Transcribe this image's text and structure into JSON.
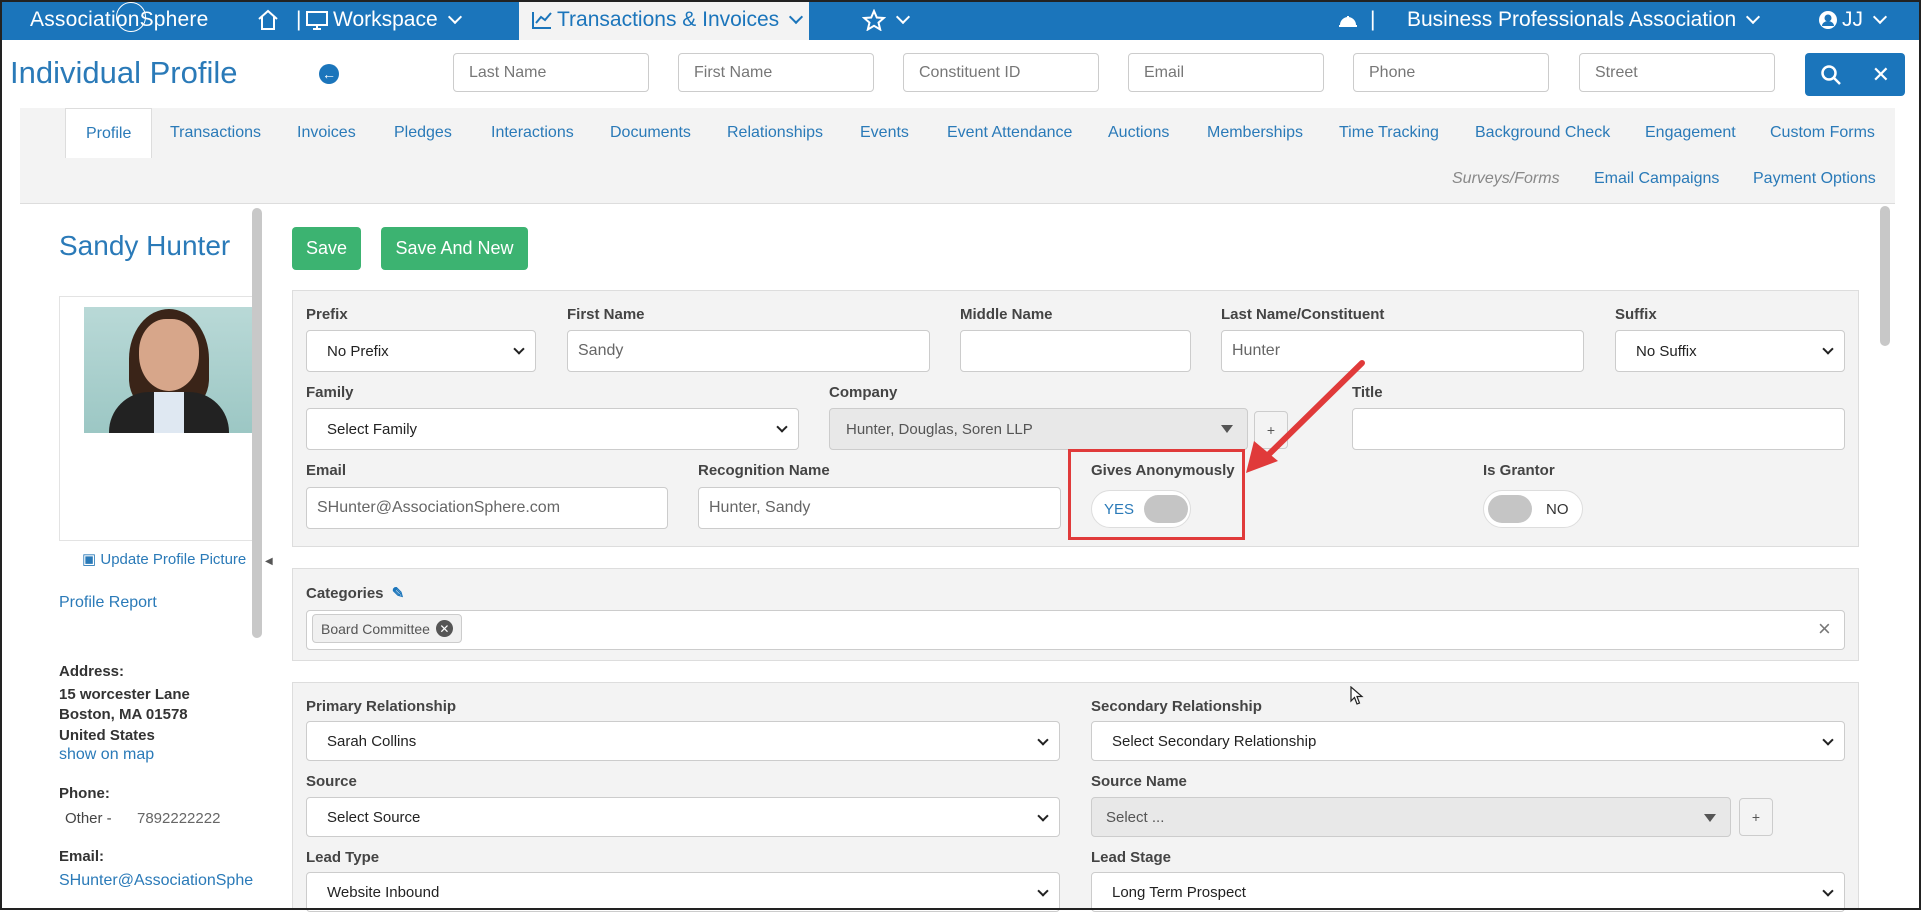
{
  "topnav": {
    "logo": "AssociationSphere",
    "workspace": "Workspace",
    "active_module": "Transactions & Invoices",
    "organization": "Business Professionals Association",
    "user_initials": "JJ",
    "separator": "|"
  },
  "header": {
    "title": "Individual Profile"
  },
  "search": {
    "last_name_placeholder": "Last Name",
    "first_name_placeholder": "First Name",
    "constituent_id_placeholder": "Constituent ID",
    "email_placeholder": "Email",
    "phone_placeholder": "Phone",
    "street_placeholder": "Street"
  },
  "tabs": {
    "row1": [
      "Profile",
      "Transactions",
      "Invoices",
      "Pledges",
      "Interactions",
      "Documents",
      "Relationships",
      "Events",
      "Event Attendance",
      "Auctions",
      "Memberships",
      "Time Tracking",
      "Background Check",
      "Engagement",
      "Custom Forms"
    ],
    "row2": [
      "Surveys/Forms",
      "Email Campaigns",
      "Payment Options"
    ]
  },
  "left": {
    "name": "Sandy Hunter",
    "update_picture": "Update Profile Picture",
    "profile_report": "Profile Report",
    "address_label": "Address:",
    "address_line1": "15 worcester Lane",
    "address_line2": "Boston, MA 01578",
    "address_line3": "United States",
    "show_on_map": "show on map",
    "phone_label": "Phone:",
    "phone_type": "Other -",
    "phone_value": "7892222222",
    "email_label": "Email:",
    "email_value": "SHunter@AssociationSphe"
  },
  "actions": {
    "save": "Save",
    "save_and_new": "Save And New"
  },
  "form": {
    "prefix_label": "Prefix",
    "prefix_value": "No Prefix",
    "first_name_label": "First Name",
    "first_name_value": "Sandy",
    "middle_name_label": "Middle Name",
    "middle_name_value": "",
    "last_name_label": "Last Name/Constituent",
    "last_name_value": "Hunter",
    "suffix_label": "Suffix",
    "suffix_value": "No Suffix",
    "family_label": "Family",
    "family_value": "Select Family",
    "company_label": "Company",
    "company_value": "Hunter, Douglas, Soren LLP",
    "title_label": "Title",
    "title_value": "",
    "email_label": "Email",
    "email_value": "SHunter@AssociationSphere.com",
    "recognition_label": "Recognition Name",
    "recognition_value": "Hunter, Sandy",
    "gives_anon_label": "Gives Anonymously",
    "gives_anon_state": "YES",
    "is_grantor_label": "Is Grantor",
    "is_grantor_state": "NO",
    "plus": "+"
  },
  "categories": {
    "label": "Categories",
    "chips": [
      "Board Committee"
    ],
    "clear": "×"
  },
  "relationships": {
    "primary_label": "Primary Relationship",
    "primary_value": "Sarah Collins",
    "secondary_label": "Secondary Relationship",
    "secondary_value": "Select Secondary Relationship",
    "source_label": "Source",
    "source_value": "Select Source",
    "source_name_label": "Source Name",
    "source_name_value": "Select ...",
    "lead_type_label": "Lead Type",
    "lead_type_value": "Website Inbound",
    "lead_stage_label": "Lead Stage",
    "lead_stage_value": "Long Term Prospect"
  },
  "colors": {
    "brand_blue": "#1b75bb",
    "green": "#3cb371",
    "annotation_red": "#e03a3a"
  }
}
